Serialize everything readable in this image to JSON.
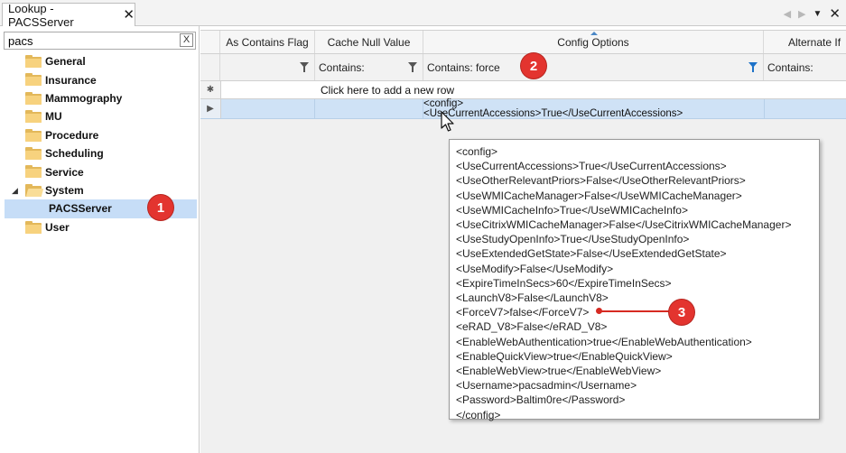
{
  "tab": {
    "title": "Lookup - PACSServer"
  },
  "search": {
    "value": "pacs",
    "clear_label": "X"
  },
  "tree": {
    "items": [
      {
        "label": "General"
      },
      {
        "label": "Insurance"
      },
      {
        "label": "Mammography"
      },
      {
        "label": "MU"
      },
      {
        "label": "Procedure"
      },
      {
        "label": "Scheduling"
      },
      {
        "label": "Service"
      },
      {
        "label": "System"
      },
      {
        "label": "PACSServer"
      },
      {
        "label": "User"
      }
    ]
  },
  "grid": {
    "columns": [
      "As Contains Flag",
      "Cache Null Value",
      "Config Options",
      "Alternate If"
    ],
    "filters": [
      "",
      "Contains:",
      "Contains: force",
      "Contains:"
    ],
    "add_row_text": "Click here to add a new row",
    "row_config_lines": [
      "<config>",
      "<UseCurrentAccessions>True</UseCurrentAccessions>"
    ]
  },
  "tooltip": {
    "lines": [
      "<config>",
      "<UseCurrentAccessions>True</UseCurrentAccessions>",
      "<UseOtherRelevantPriors>False</UseOtherRelevantPriors>",
      "<UseWMICacheManager>False</UseWMICacheManager>",
      "<UseWMICacheInfo>True</UseWMICacheInfo>",
      "<UseCitrixWMICacheManager>False</UseCitrixWMICacheManager>",
      "<UseStudyOpenInfo>True</UseStudyOpenInfo>",
      "<UseExtendedGetState>False</UseExtendedGetState>",
      "<UseModify>False</UseModify>",
      "<ExpireTimeInSecs>60</ExpireTimeInSecs>",
      "<LaunchV8>False</LaunchV8>",
      "<ForceV7>false</ForceV7>",
      "<eRAD_V8>False</eRAD_V8>",
      "<EnableWebAuthentication>true</EnableWebAuthentication>",
      "<EnableQuickView>true</EnableQuickView>",
      "<EnableWebView>true</EnableWebView>",
      "<Username>pacsadmin</Username>",
      "<Password>Baltim0re</Password>",
      "</config>"
    ]
  },
  "annotations": [
    "1",
    "2",
    "3"
  ],
  "colors": {
    "selection": "#c6ddf7",
    "row_highlight": "#cfe2f6",
    "badge": "#e3342f",
    "filter_active": "#1e73c8"
  }
}
